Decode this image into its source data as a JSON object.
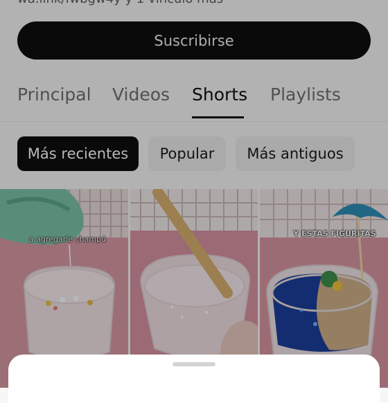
{
  "channel": {
    "links_text": "wa.link/fwbgw4y y 1 vínculo más",
    "subscribe_label": "Suscribirse"
  },
  "tabs": [
    {
      "label": "Principal",
      "active": false
    },
    {
      "label": "Videos",
      "active": false
    },
    {
      "label": "Shorts",
      "active": true
    },
    {
      "label": "Playlists",
      "active": false
    }
  ],
  "filters": [
    {
      "label": "Más recientes",
      "active": true
    },
    {
      "label": "Popular",
      "active": false
    },
    {
      "label": "Más antiguos",
      "active": false
    }
  ],
  "shorts": [
    {
      "caption": "a agregarle champú"
    },
    {
      "caption": ""
    },
    {
      "caption": "Y ESTAS FIGURITAS"
    }
  ],
  "colors": {
    "overlay": "rgba(0,0,0,0.28)",
    "accent": "#0f0f0f"
  }
}
